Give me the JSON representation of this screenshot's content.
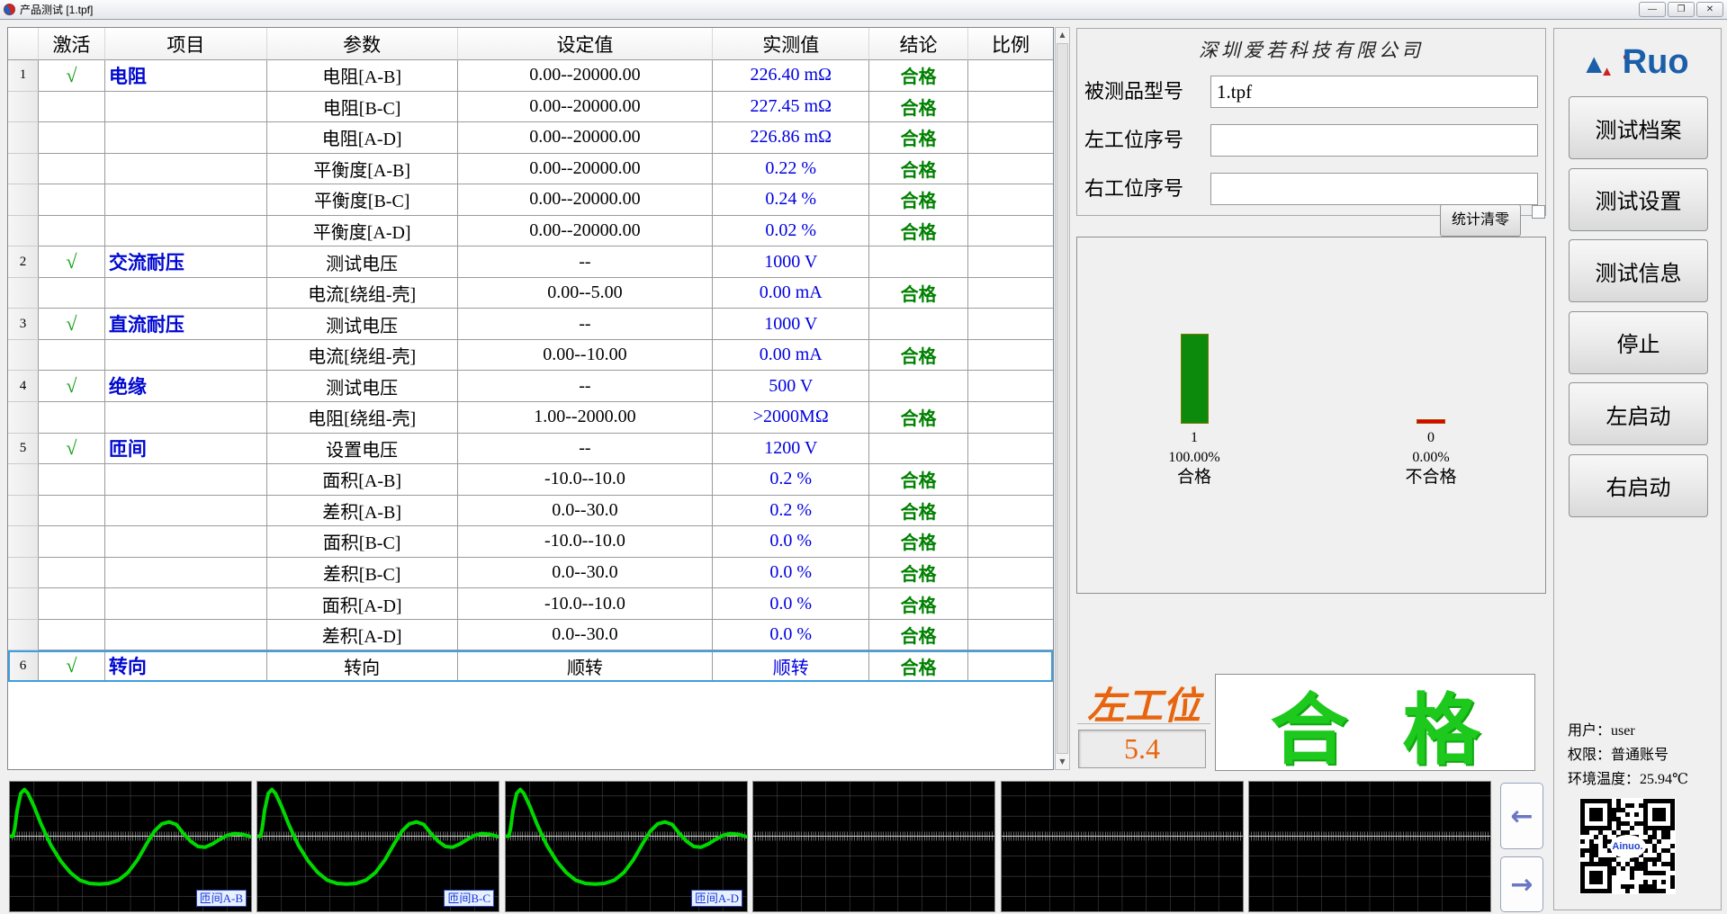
{
  "window": {
    "title": "产品测试 [1.tpf]",
    "minimize": "—",
    "maximize": "❐",
    "close": "✕"
  },
  "table": {
    "headers": [
      "",
      "激活",
      "项目",
      "参数",
      "设定值",
      "实测值",
      "结论",
      "比例"
    ],
    "rows": [
      {
        "n": "1",
        "chk": "√",
        "item": "电阻",
        "param": "电阻[A-B]",
        "set": "0.00--20000.00",
        "meas": "226.40 mΩ",
        "res": "合格"
      },
      {
        "n": "",
        "chk": "",
        "item": "",
        "param": "电阻[B-C]",
        "set": "0.00--20000.00",
        "meas": "227.45 mΩ",
        "res": "合格"
      },
      {
        "n": "",
        "chk": "",
        "item": "",
        "param": "电阻[A-D]",
        "set": "0.00--20000.00",
        "meas": "226.86 mΩ",
        "res": "合格"
      },
      {
        "n": "",
        "chk": "",
        "item": "",
        "param": "平衡度[A-B]",
        "set": "0.00--20000.00",
        "meas": "0.22 %",
        "res": "合格"
      },
      {
        "n": "",
        "chk": "",
        "item": "",
        "param": "平衡度[B-C]",
        "set": "0.00--20000.00",
        "meas": "0.24 %",
        "res": "合格"
      },
      {
        "n": "",
        "chk": "",
        "item": "",
        "param": "平衡度[A-D]",
        "set": "0.00--20000.00",
        "meas": "0.02 %",
        "res": "合格"
      },
      {
        "n": "2",
        "chk": "√",
        "item": "交流耐压",
        "param": "测试电压",
        "set": "--",
        "meas": "1000 V",
        "res": ""
      },
      {
        "n": "",
        "chk": "",
        "item": "",
        "param": "电流[绕组-壳]",
        "set": "0.00--5.00",
        "meas": "0.00 mA",
        "res": "合格"
      },
      {
        "n": "3",
        "chk": "√",
        "item": "直流耐压",
        "param": "测试电压",
        "set": "--",
        "meas": "1000 V",
        "res": ""
      },
      {
        "n": "",
        "chk": "",
        "item": "",
        "param": "电流[绕组-壳]",
        "set": "0.00--10.00",
        "meas": "0.00 mA",
        "res": "合格"
      },
      {
        "n": "4",
        "chk": "√",
        "item": "绝缘",
        "param": "测试电压",
        "set": "--",
        "meas": "500 V",
        "res": ""
      },
      {
        "n": "",
        "chk": "",
        "item": "",
        "param": "电阻[绕组-壳]",
        "set": "1.00--2000.00",
        "meas": ">2000MΩ",
        "res": "合格"
      },
      {
        "n": "5",
        "chk": "√",
        "item": "匝间",
        "param": "设置电压",
        "set": "--",
        "meas": "1200 V",
        "res": ""
      },
      {
        "n": "",
        "chk": "",
        "item": "",
        "param": "面积[A-B]",
        "set": "-10.0--10.0",
        "meas": "0.2 %",
        "res": "合格"
      },
      {
        "n": "",
        "chk": "",
        "item": "",
        "param": "差积[A-B]",
        "set": "0.0--30.0",
        "meas": "0.2 %",
        "res": "合格"
      },
      {
        "n": "",
        "chk": "",
        "item": "",
        "param": "面积[B-C]",
        "set": "-10.0--10.0",
        "meas": "0.0 %",
        "res": "合格"
      },
      {
        "n": "",
        "chk": "",
        "item": "",
        "param": "差积[B-C]",
        "set": "0.0--30.0",
        "meas": "0.0 %",
        "res": "合格"
      },
      {
        "n": "",
        "chk": "",
        "item": "",
        "param": "面积[A-D]",
        "set": "-10.0--10.0",
        "meas": "0.0 %",
        "res": "合格"
      },
      {
        "n": "",
        "chk": "",
        "item": "",
        "param": "差积[A-D]",
        "set": "0.0--30.0",
        "meas": "0.0 %",
        "res": "合格"
      },
      {
        "n": "6",
        "chk": "√",
        "item": "转向",
        "param": "转向",
        "set": "顺转",
        "meas": "顺转",
        "res": "合格",
        "sel": true
      }
    ]
  },
  "panel": {
    "company": "深圳爱若科技有限公司",
    "model_label": "被测品型号",
    "model_value": "1.tpf",
    "left_sn_label": "左工位序号",
    "left_sn_value": "",
    "right_sn_label": "右工位序号",
    "right_sn_value": "",
    "clear_stats_label": "统计清零",
    "stats": {
      "pass": {
        "count": "1",
        "pct": "100.00%",
        "pct_value": 100,
        "label": "合格",
        "color": "#0b8a0b"
      },
      "fail": {
        "count": "0",
        "pct": "0.00%",
        "pct_value": 0,
        "label": "不合格",
        "color": "#e00000"
      }
    },
    "station_label": "左工位",
    "station_value": "5.4",
    "verdict_char1": "合",
    "verdict_char2": "格"
  },
  "sidebar": {
    "logo_text": "Ruo",
    "buttons": [
      "测试档案",
      "测试设置",
      "测试信息",
      "停止",
      "左启动",
      "右启动"
    ],
    "user_line": "用户：user",
    "perm_line": "权限：普通账号",
    "temp_line": "环境温度：25.94℃",
    "qr_text": "Ainuo."
  },
  "waveforms": {
    "labels": [
      "匝间A-B",
      "匝间B-C",
      "匝间A-D"
    ],
    "panel_count": 6,
    "axis_y": 0.42,
    "trace_color": "#00d800",
    "points": [
      [
        0,
        0.42
      ],
      [
        0.013,
        0.42
      ],
      [
        0.02,
        0.36
      ],
      [
        0.03,
        0.22
      ],
      [
        0.045,
        0.09
      ],
      [
        0.06,
        0.06
      ],
      [
        0.075,
        0.09
      ],
      [
        0.1,
        0.19
      ],
      [
        0.13,
        0.33
      ],
      [
        0.17,
        0.49
      ],
      [
        0.21,
        0.61
      ],
      [
        0.25,
        0.7
      ],
      [
        0.29,
        0.76
      ],
      [
        0.33,
        0.785
      ],
      [
        0.37,
        0.79
      ],
      [
        0.41,
        0.785
      ],
      [
        0.45,
        0.76
      ],
      [
        0.49,
        0.7
      ],
      [
        0.53,
        0.6
      ],
      [
        0.57,
        0.47
      ],
      [
        0.6,
        0.38
      ],
      [
        0.63,
        0.325
      ],
      [
        0.66,
        0.31
      ],
      [
        0.69,
        0.33
      ],
      [
        0.72,
        0.4
      ],
      [
        0.75,
        0.46
      ],
      [
        0.78,
        0.5
      ],
      [
        0.81,
        0.505
      ],
      [
        0.84,
        0.48
      ],
      [
        0.87,
        0.445
      ],
      [
        0.9,
        0.415
      ],
      [
        0.93,
        0.4
      ],
      [
        0.96,
        0.405
      ],
      [
        1,
        0.425
      ]
    ],
    "nav_left": "←",
    "nav_right": "→"
  },
  "scrollbar": {
    "up": "▲",
    "down": "▼"
  }
}
